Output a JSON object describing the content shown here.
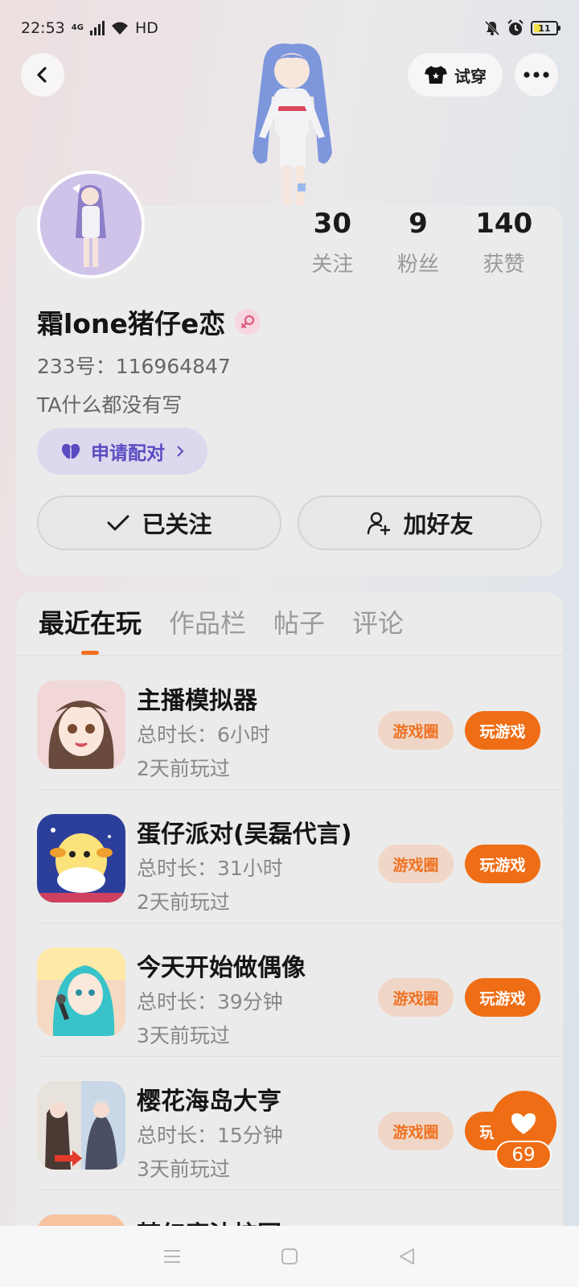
{
  "status": {
    "time": "22:53",
    "network": "4G",
    "hd": "HD",
    "battery": "11"
  },
  "header": {
    "tryon_label": "试穿"
  },
  "profile": {
    "stats": [
      {
        "value": "30",
        "label": "关注"
      },
      {
        "value": "9",
        "label": "粉丝"
      },
      {
        "value": "140",
        "label": "获赞"
      }
    ],
    "username": "霜lone猪仔e恋",
    "uid": "233号：116964847",
    "bio": "TA什么都没有写",
    "pair_label": "申请配对",
    "follow_label": "已关注",
    "add_friend_label": "加好友"
  },
  "tabs": [
    {
      "label": "最近在玩",
      "active": true
    },
    {
      "label": "作品栏",
      "active": false
    },
    {
      "label": "帖子",
      "active": false
    },
    {
      "label": "评论",
      "active": false
    }
  ],
  "games": [
    {
      "name": "主播模拟器",
      "time": "总时长：6小时",
      "last": "2天前玩过",
      "circle_label": "游戏圈",
      "play_label": "玩游戏"
    },
    {
      "name": "蛋仔派对(吴磊代言)",
      "time": "总时长：31小时",
      "last": "2天前玩过",
      "circle_label": "游戏圈",
      "play_label": "玩游戏"
    },
    {
      "name": "今天开始做偶像",
      "time": "总时长：39分钟",
      "last": "3天前玩过",
      "circle_label": "游戏圈",
      "play_label": "玩游戏"
    },
    {
      "name": "樱花海岛大亨",
      "time": "总时长：15分钟",
      "last": "3天前玩过",
      "circle_label": "游戏圈",
      "play_label": "玩游戏"
    },
    {
      "name": "梦幻魔法校园",
      "time": "",
      "last": "",
      "circle_label": "",
      "play_label": ""
    }
  ],
  "floating": {
    "like_count": "69"
  },
  "colors": {
    "accent": "#ef6d14",
    "pair_text": "#5a4cc0",
    "pair_bg": "#dcd8ee"
  }
}
